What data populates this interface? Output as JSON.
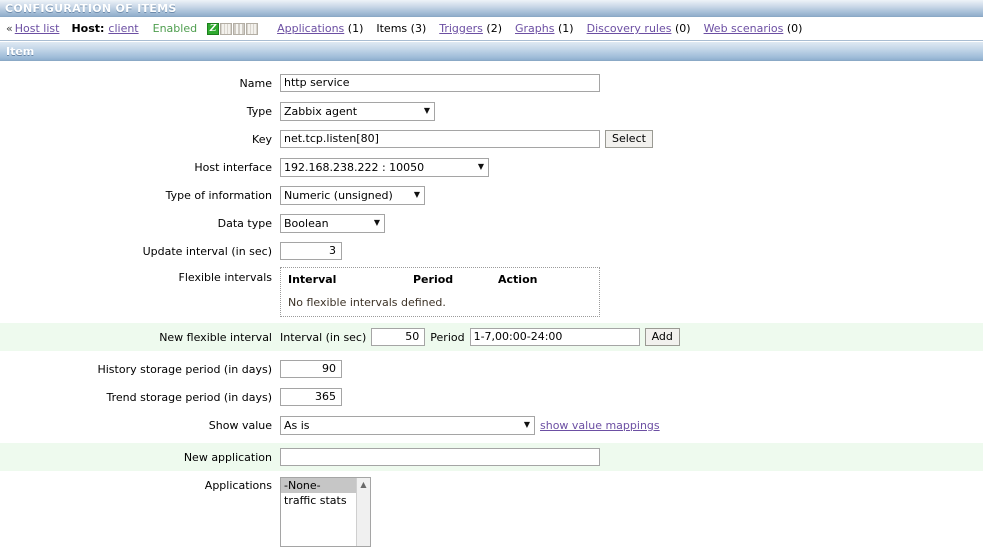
{
  "page": {
    "title": "CONFIGURATION OF ITEMS"
  },
  "nav": {
    "chevron": "«",
    "host_list_link": "Host list",
    "host_label": "Host:",
    "host_name": "client",
    "status": "Enabled",
    "icons": [
      "zabbix-agent-icon",
      "snmp-icon",
      "jmx-icon",
      "ipmi-icon"
    ],
    "items": [
      {
        "label": "Applications",
        "count": "(1)",
        "link": true
      },
      {
        "label": "Items",
        "count": "(3)",
        "link": false
      },
      {
        "label": "Triggers",
        "count": "(2)",
        "link": true
      },
      {
        "label": "Graphs",
        "count": "(1)",
        "link": true
      },
      {
        "label": "Discovery rules",
        "count": "(0)",
        "link": true
      },
      {
        "label": "Web scenarios",
        "count": "(0)",
        "link": true
      }
    ]
  },
  "section": {
    "title": "Item"
  },
  "form": {
    "name": {
      "label": "Name",
      "value": "http service"
    },
    "type": {
      "label": "Type",
      "value": "Zabbix agent"
    },
    "key": {
      "label": "Key",
      "value": "net.tcp.listen[80]",
      "select_button": "Select"
    },
    "host_interface": {
      "label": "Host interface",
      "value": "192.168.238.222 : 10050"
    },
    "type_of_information": {
      "label": "Type of information",
      "value": "Numeric (unsigned)"
    },
    "data_type": {
      "label": "Data type",
      "value": "Boolean"
    },
    "update_interval": {
      "label": "Update interval (in sec)",
      "value": "3"
    },
    "flexible_intervals": {
      "label": "Flexible intervals",
      "columns": [
        "Interval",
        "Period",
        "Action"
      ],
      "empty_text": "No flexible intervals defined."
    },
    "new_flexible_interval": {
      "label": "New flexible interval",
      "interval_label": "Interval (in sec)",
      "interval_value": "50",
      "period_label": "Period",
      "period_value": "1-7,00:00-24:00",
      "add_button": "Add"
    },
    "history_storage": {
      "label": "History storage period (in days)",
      "value": "90"
    },
    "trend_storage": {
      "label": "Trend storage period (in days)",
      "value": "365"
    },
    "show_value": {
      "label": "Show value",
      "value": "As is",
      "mappings_link": "show value mappings"
    },
    "new_application": {
      "label": "New application",
      "value": "",
      "placeholder": ""
    },
    "applications": {
      "label": "Applications",
      "options": [
        "-None-",
        "traffic stats"
      ],
      "selected": "-None-"
    }
  },
  "colors": {
    "accent_blue": "#9fbcd8",
    "link_purple": "#6c4fa3",
    "status_green": "#4f9e4f",
    "row_green": "#eefaee",
    "agent_icon_green": "#2faa2f"
  }
}
